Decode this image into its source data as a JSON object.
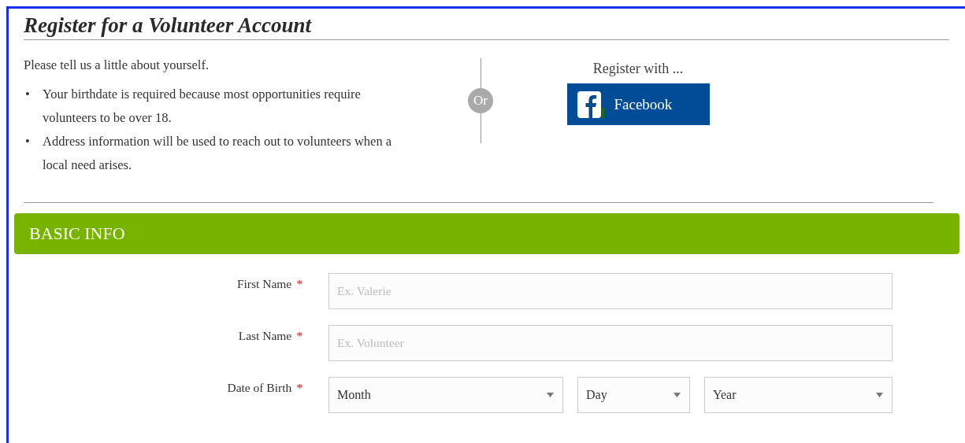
{
  "page": {
    "title": "Register for a Volunteer Account"
  },
  "intro": {
    "lead": "Please tell us a little about yourself.",
    "bullets": [
      {
        "marker": "•",
        "text": "Your birthdate is required because most opportunities require volunteers to be over 18."
      },
      {
        "marker": "•",
        "text": "Address information will be used to reach out to volunteers when a local need arises."
      }
    ]
  },
  "divider": {
    "label": "Or"
  },
  "social": {
    "heading": "Register with ...",
    "button": "Facebook"
  },
  "section": {
    "title": "BASIC INFO"
  },
  "fields": [
    {
      "label": "First Name",
      "required_mark": "*",
      "controls": [
        {
          "kind": "text",
          "placeholder": "Ex. Valerie"
        }
      ]
    },
    {
      "label": "Last Name",
      "required_mark": "*",
      "controls": [
        {
          "kind": "text",
          "placeholder": "Ex. Volunteer"
        }
      ]
    },
    {
      "label": "Date of Birth",
      "required_mark": "*",
      "controls": [
        {
          "kind": "select",
          "value": "Month"
        },
        {
          "kind": "select",
          "value": "Day"
        },
        {
          "kind": "select",
          "value": "Year"
        }
      ]
    }
  ]
}
